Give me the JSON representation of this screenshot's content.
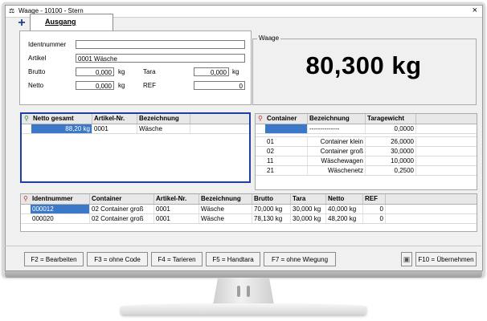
{
  "window": {
    "title": "Waage - 10100 - Stern",
    "close_glyph": "×",
    "icon": "scale-icon"
  },
  "toolbar": {
    "add_glyph": "+"
  },
  "tab": {
    "label": "Ausgang"
  },
  "form": {
    "ident_label": "Identnummer",
    "ident_value": "",
    "artikel_label": "Artikel",
    "artikel_value": "0001  Wäsche",
    "brutto_label": "Brutto",
    "brutto_value": "0,000",
    "brutto_unit": "kg",
    "tara_label": "Tara",
    "tara_value": "0,000",
    "tara_unit": "kg",
    "netto_label": "Netto",
    "netto_value": "0,000",
    "netto_unit": "kg",
    "ref_label": "REF",
    "ref_value": "0"
  },
  "waage": {
    "legend": "Waage",
    "value": "80,300 kg"
  },
  "netto_grid": {
    "columns": [
      "Netto gesamt",
      "Artikel-Nr.",
      "Bezeichnung"
    ],
    "rows": [
      {
        "netto": "88,20 kg",
        "artikel": "0001",
        "bezeichnung": "Wäsche"
      }
    ]
  },
  "container_grid": {
    "columns": [
      "Container",
      "Bezeichnung",
      "Taragewicht"
    ],
    "rows": [
      {
        "container": "",
        "bezeichnung": "--------------",
        "tara": "0,0000"
      },
      {
        "container": "01",
        "bezeichnung": "Container klein",
        "tara": "26,0000"
      },
      {
        "container": "02",
        "bezeichnung": "Container groß",
        "tara": "30,0000"
      },
      {
        "container": "11",
        "bezeichnung": "Wäschewagen",
        "tara": "10,0000"
      },
      {
        "container": "21",
        "bezeichnung": "Wäschenetz",
        "tara": "0,2500"
      }
    ]
  },
  "ident_grid": {
    "columns": [
      "Identnummer",
      "Container",
      "Artikel-Nr.",
      "Bezeichnung",
      "Brutto",
      "Tara",
      "Netto",
      "REF"
    ],
    "rows": [
      {
        "ident": "000012",
        "container": "02  Container groß",
        "artikel": "0001",
        "bezeichnung": "Wäsche",
        "brutto": "70,000 kg",
        "tara": "30,000 kg",
        "netto": "40,000 kg",
        "ref": "0"
      },
      {
        "ident": "000020",
        "container": "02  Container groß",
        "artikel": "0001",
        "bezeichnung": "Wäsche",
        "brutto": "78,130 kg",
        "tara": "30,000 kg",
        "netto": "48,200 kg",
        "ref": "0"
      }
    ]
  },
  "buttons": {
    "bearbeiten": "F2 = Bearbeiten",
    "ohne_code": "F3 = ohne Code",
    "tarieren": "F4 = Tarieren",
    "handtara": "F5 = Handtara",
    "ohne_wiegung": "F7 = ohne Wiegung",
    "uebernehmen": "F10 = Übernehmen"
  },
  "colors": {
    "selection": "#3c78c8",
    "focus_border": "#1f3ea6",
    "add_icon": "#1a3f8f"
  }
}
